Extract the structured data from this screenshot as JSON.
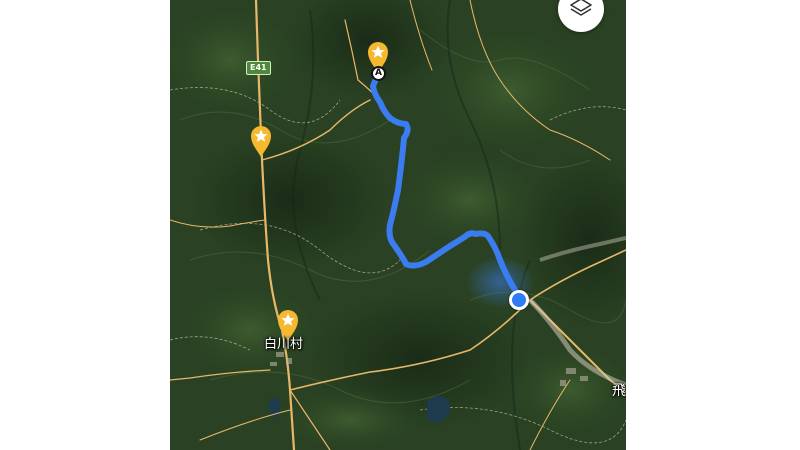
{
  "map": {
    "view": "satellite",
    "road_shield": "E41",
    "place_label": "白川村",
    "edge_label": "飛",
    "waypoint_label": "A",
    "route_color": "#3b7df0",
    "pin_color": "#f5b82e",
    "location_dot_color": "#2f7cf6",
    "road_color": "#e8b86a"
  },
  "markers": [
    {
      "name": "star-pin-destination",
      "icon": "star-icon"
    },
    {
      "name": "star-pin-west",
      "icon": "star-icon"
    },
    {
      "name": "star-pin-shirakawa",
      "icon": "star-icon"
    }
  ],
  "controls": {
    "layers_icon": "layers-icon"
  }
}
